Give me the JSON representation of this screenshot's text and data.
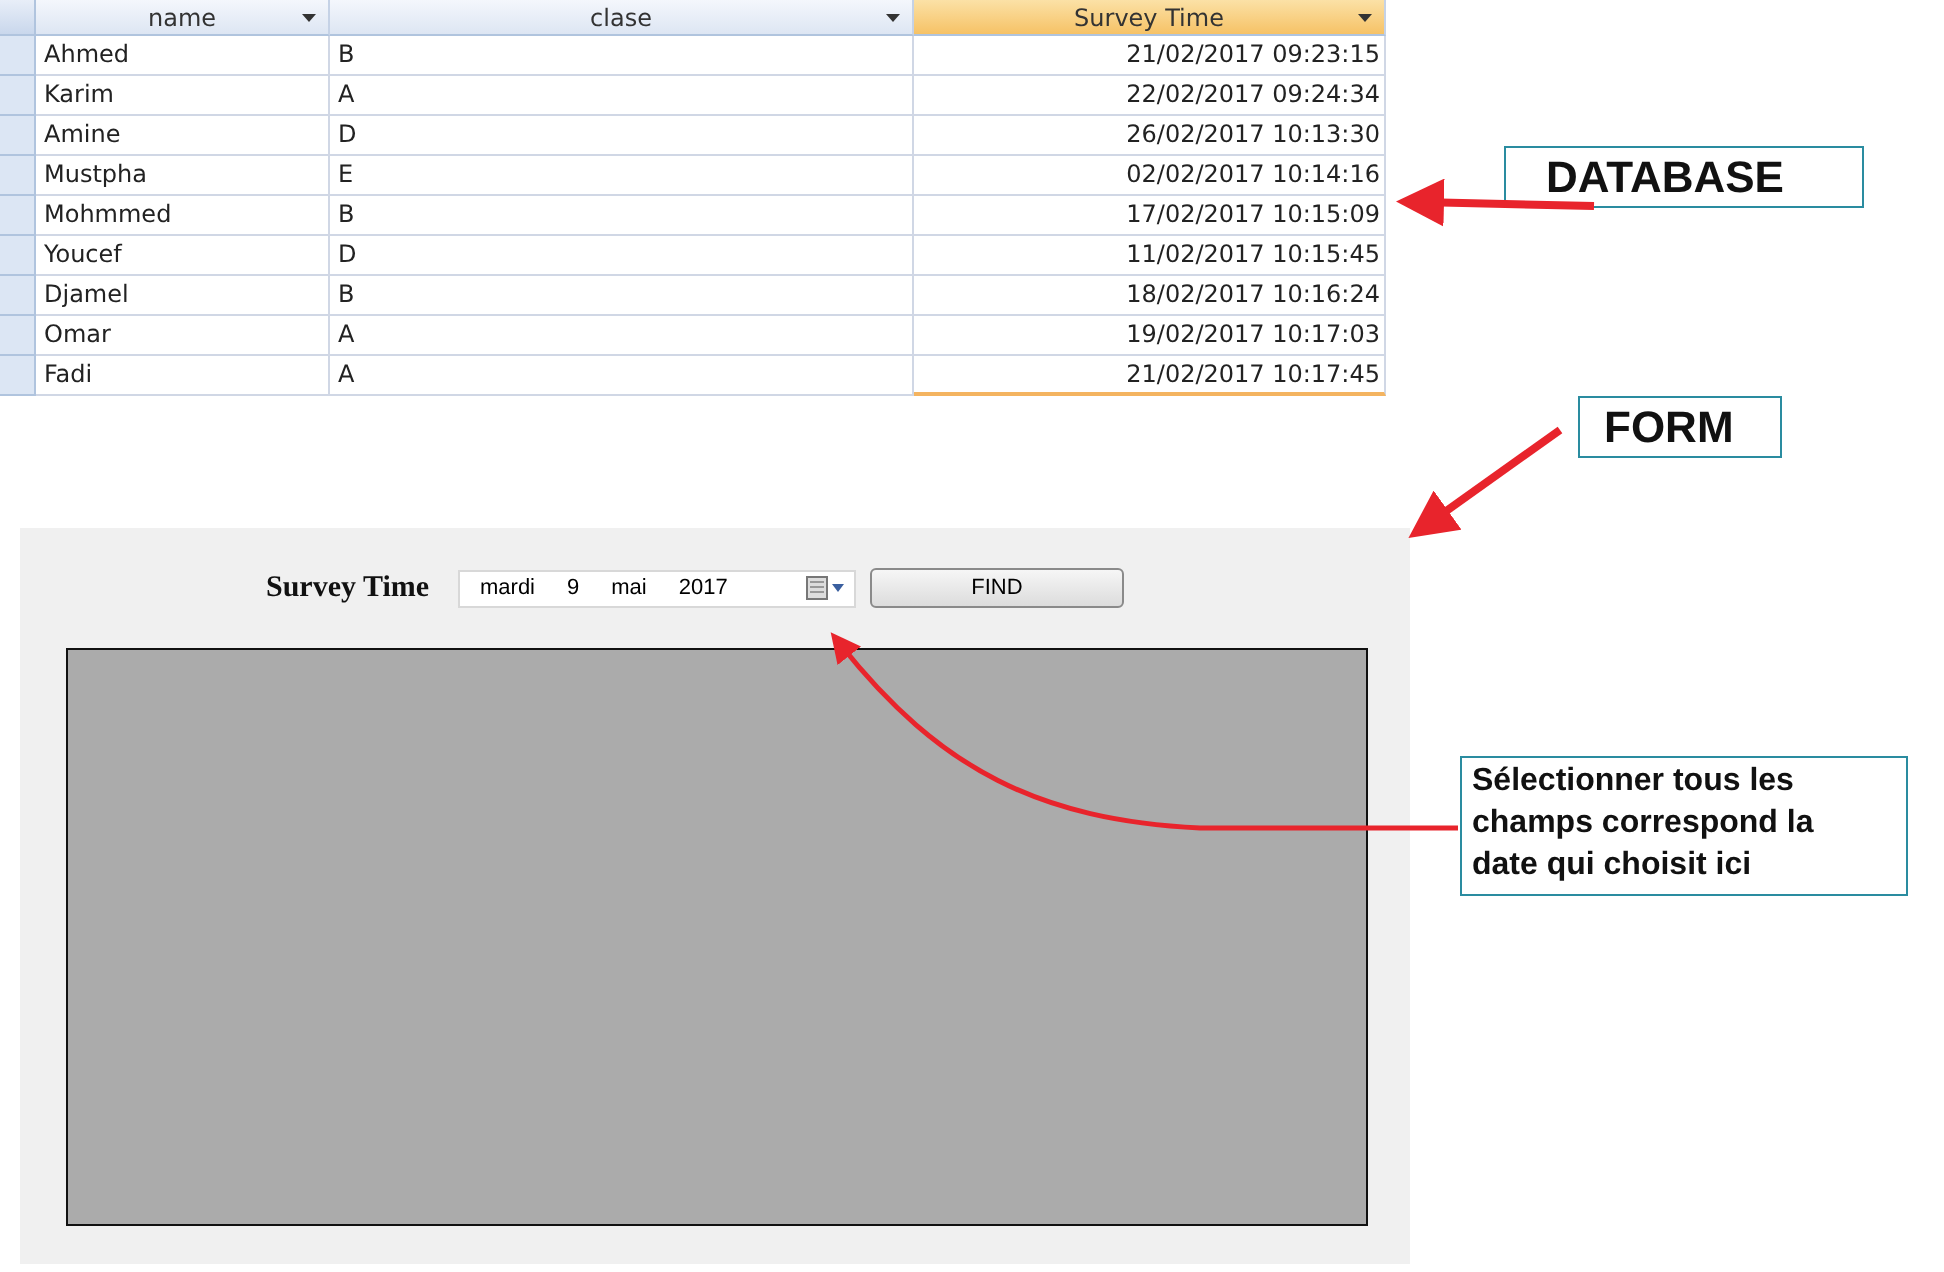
{
  "table": {
    "columns": [
      {
        "label": "name",
        "selected": false
      },
      {
        "label": "clase",
        "selected": false
      },
      {
        "label": "Survey Time",
        "selected": true
      }
    ],
    "rows": [
      [
        "Ahmed",
        "B",
        "21/02/2017 09:23:15"
      ],
      [
        "Karim",
        "A",
        "22/02/2017 09:24:34"
      ],
      [
        "Amine",
        "D",
        "26/02/2017 10:13:30"
      ],
      [
        "Mustpha",
        "E",
        "02/02/2017 10:14:16"
      ],
      [
        "Mohmmed",
        "B",
        "17/02/2017 10:15:09"
      ],
      [
        "Youcef",
        "D",
        "11/02/2017 10:15:45"
      ],
      [
        "Djamel",
        "B",
        "18/02/2017 10:16:24"
      ],
      [
        "Omar",
        "A",
        "19/02/2017 10:17:03"
      ],
      [
        "Fadi",
        "A",
        "21/02/2017 10:17:45"
      ]
    ]
  },
  "form": {
    "field_label": "Survey Time",
    "date_picker": {
      "parts": [
        "mardi",
        "9",
        "mai",
        "2017"
      ]
    },
    "find_button": "FIND"
  },
  "callouts": [
    {
      "text": "DATABASE"
    },
    {
      "text": "FORM"
    },
    {
      "text": "Sélectionner tous les champs correspond la date qui choisit ici"
    }
  ]
}
